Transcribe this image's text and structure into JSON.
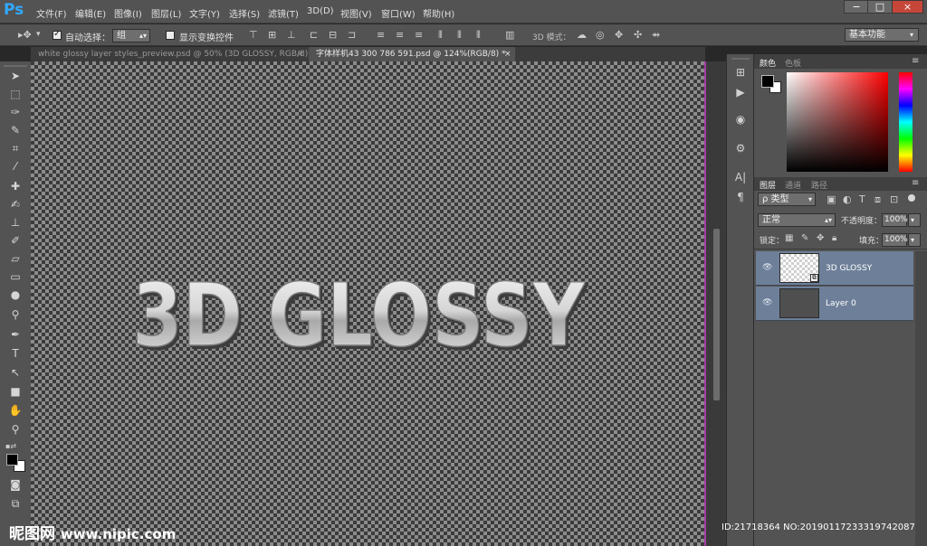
{
  "app": {
    "logo": "Ps"
  },
  "menu": [
    "文件(F)",
    "编辑(E)",
    "图像(I)",
    "图层(L)",
    "文字(Y)",
    "选择(S)",
    "滤镜(T)",
    "3D(D)",
    "视图(V)",
    "窗口(W)",
    "帮助(H)"
  ],
  "window_controls": {
    "minimize": "−",
    "maximize": "□",
    "close": "×"
  },
  "options": {
    "auto_select_label": "自动选择：",
    "auto_select_value": "组",
    "show_transform_label": "显示变换控件",
    "mode_3d_label": "3D 模式：",
    "workspace": "基本功能"
  },
  "tabs": [
    {
      "label": "white glossy layer styles_preview.psd @ 50% (3D GLOSSY, RGB/8) *",
      "close": "×"
    },
    {
      "label": "字体样机43 300 786 591.psd @ 124%(RGB/8) *",
      "close": "×"
    }
  ],
  "canvas_text": "3D GLOSSY",
  "color_panel": {
    "tabs": [
      "颜色",
      "色板"
    ]
  },
  "layers_panel": {
    "tabs": [
      "图层",
      "通道",
      "路径"
    ],
    "filter_kind": "ρ 类型",
    "blend_mode": "正常",
    "opacity_label": "不透明度：",
    "opacity_value": "100%",
    "lock_label": "锁定：",
    "fill_label": "填充：",
    "fill_value": "100%",
    "layers": [
      {
        "name": "3D GLOSSY",
        "visible": true
      },
      {
        "name": "Layer 0",
        "visible": true
      }
    ]
  },
  "watermark": {
    "brand": "昵图网",
    "url": "www.nipic.com"
  },
  "image_id": "ID:21718364 NO:20190117233319742087",
  "colors": {
    "accent": "#31a8ff",
    "layer_selected": "#6e8099",
    "canvas_edge": "#a53ca5"
  }
}
